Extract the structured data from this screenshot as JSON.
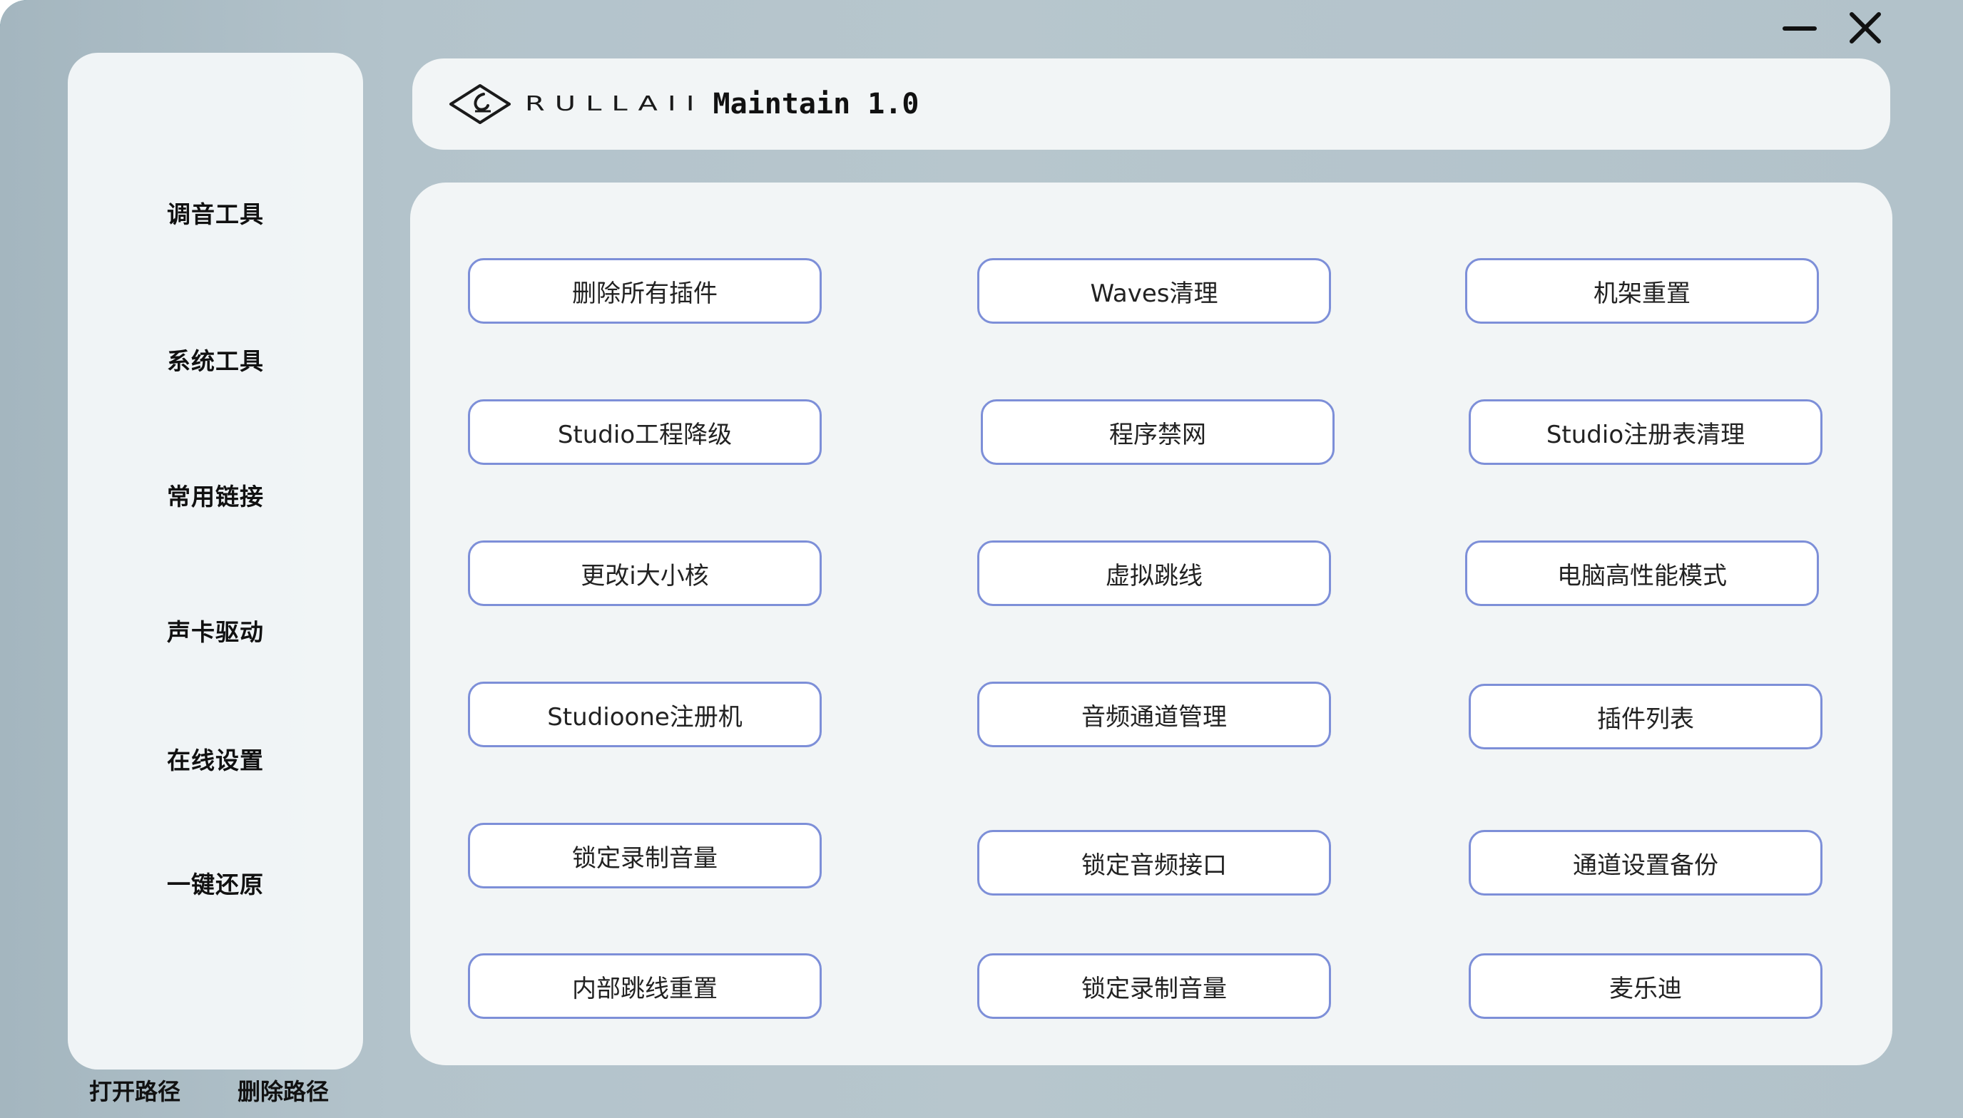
{
  "window": {
    "brand": "RULLAII",
    "title": "Maintain 1.0"
  },
  "sidebar": {
    "items": [
      {
        "label": "调音工具"
      },
      {
        "label": "系统工具"
      },
      {
        "label": "常用链接"
      },
      {
        "label": "声卡驱动"
      },
      {
        "label": "在线设置"
      },
      {
        "label": "一键还原"
      }
    ],
    "footer": {
      "open_path": "打开路径",
      "delete_path": "删除路径"
    }
  },
  "tools": [
    {
      "label": "删除所有插件"
    },
    {
      "label": "Waves清理"
    },
    {
      "label": "机架重置"
    },
    {
      "label": "Studio工程降级"
    },
    {
      "label": "程序禁网"
    },
    {
      "label": "Studio注册表清理"
    },
    {
      "label": "更改i大小核"
    },
    {
      "label": "虚拟跳线"
    },
    {
      "label": "电脑高性能模式"
    },
    {
      "label": "Studioone注册机"
    },
    {
      "label": "音频通道管理"
    },
    {
      "label": "插件列表"
    },
    {
      "label": "锁定录制音量"
    },
    {
      "label": "锁定音频接口"
    },
    {
      "label": "通道设置备份"
    },
    {
      "label": "内部跳线重置"
    },
    {
      "label": "锁定录制音量"
    },
    {
      "label": "麦乐迪"
    }
  ],
  "colors": {
    "button_border": "#7d8fd8",
    "panel_bg": "#f2f5f6",
    "window_bg": "#b5c5cc"
  },
  "icons": {
    "logo": "rullaii-logo-icon",
    "minimize": "minimize-icon",
    "close": "close-icon"
  }
}
